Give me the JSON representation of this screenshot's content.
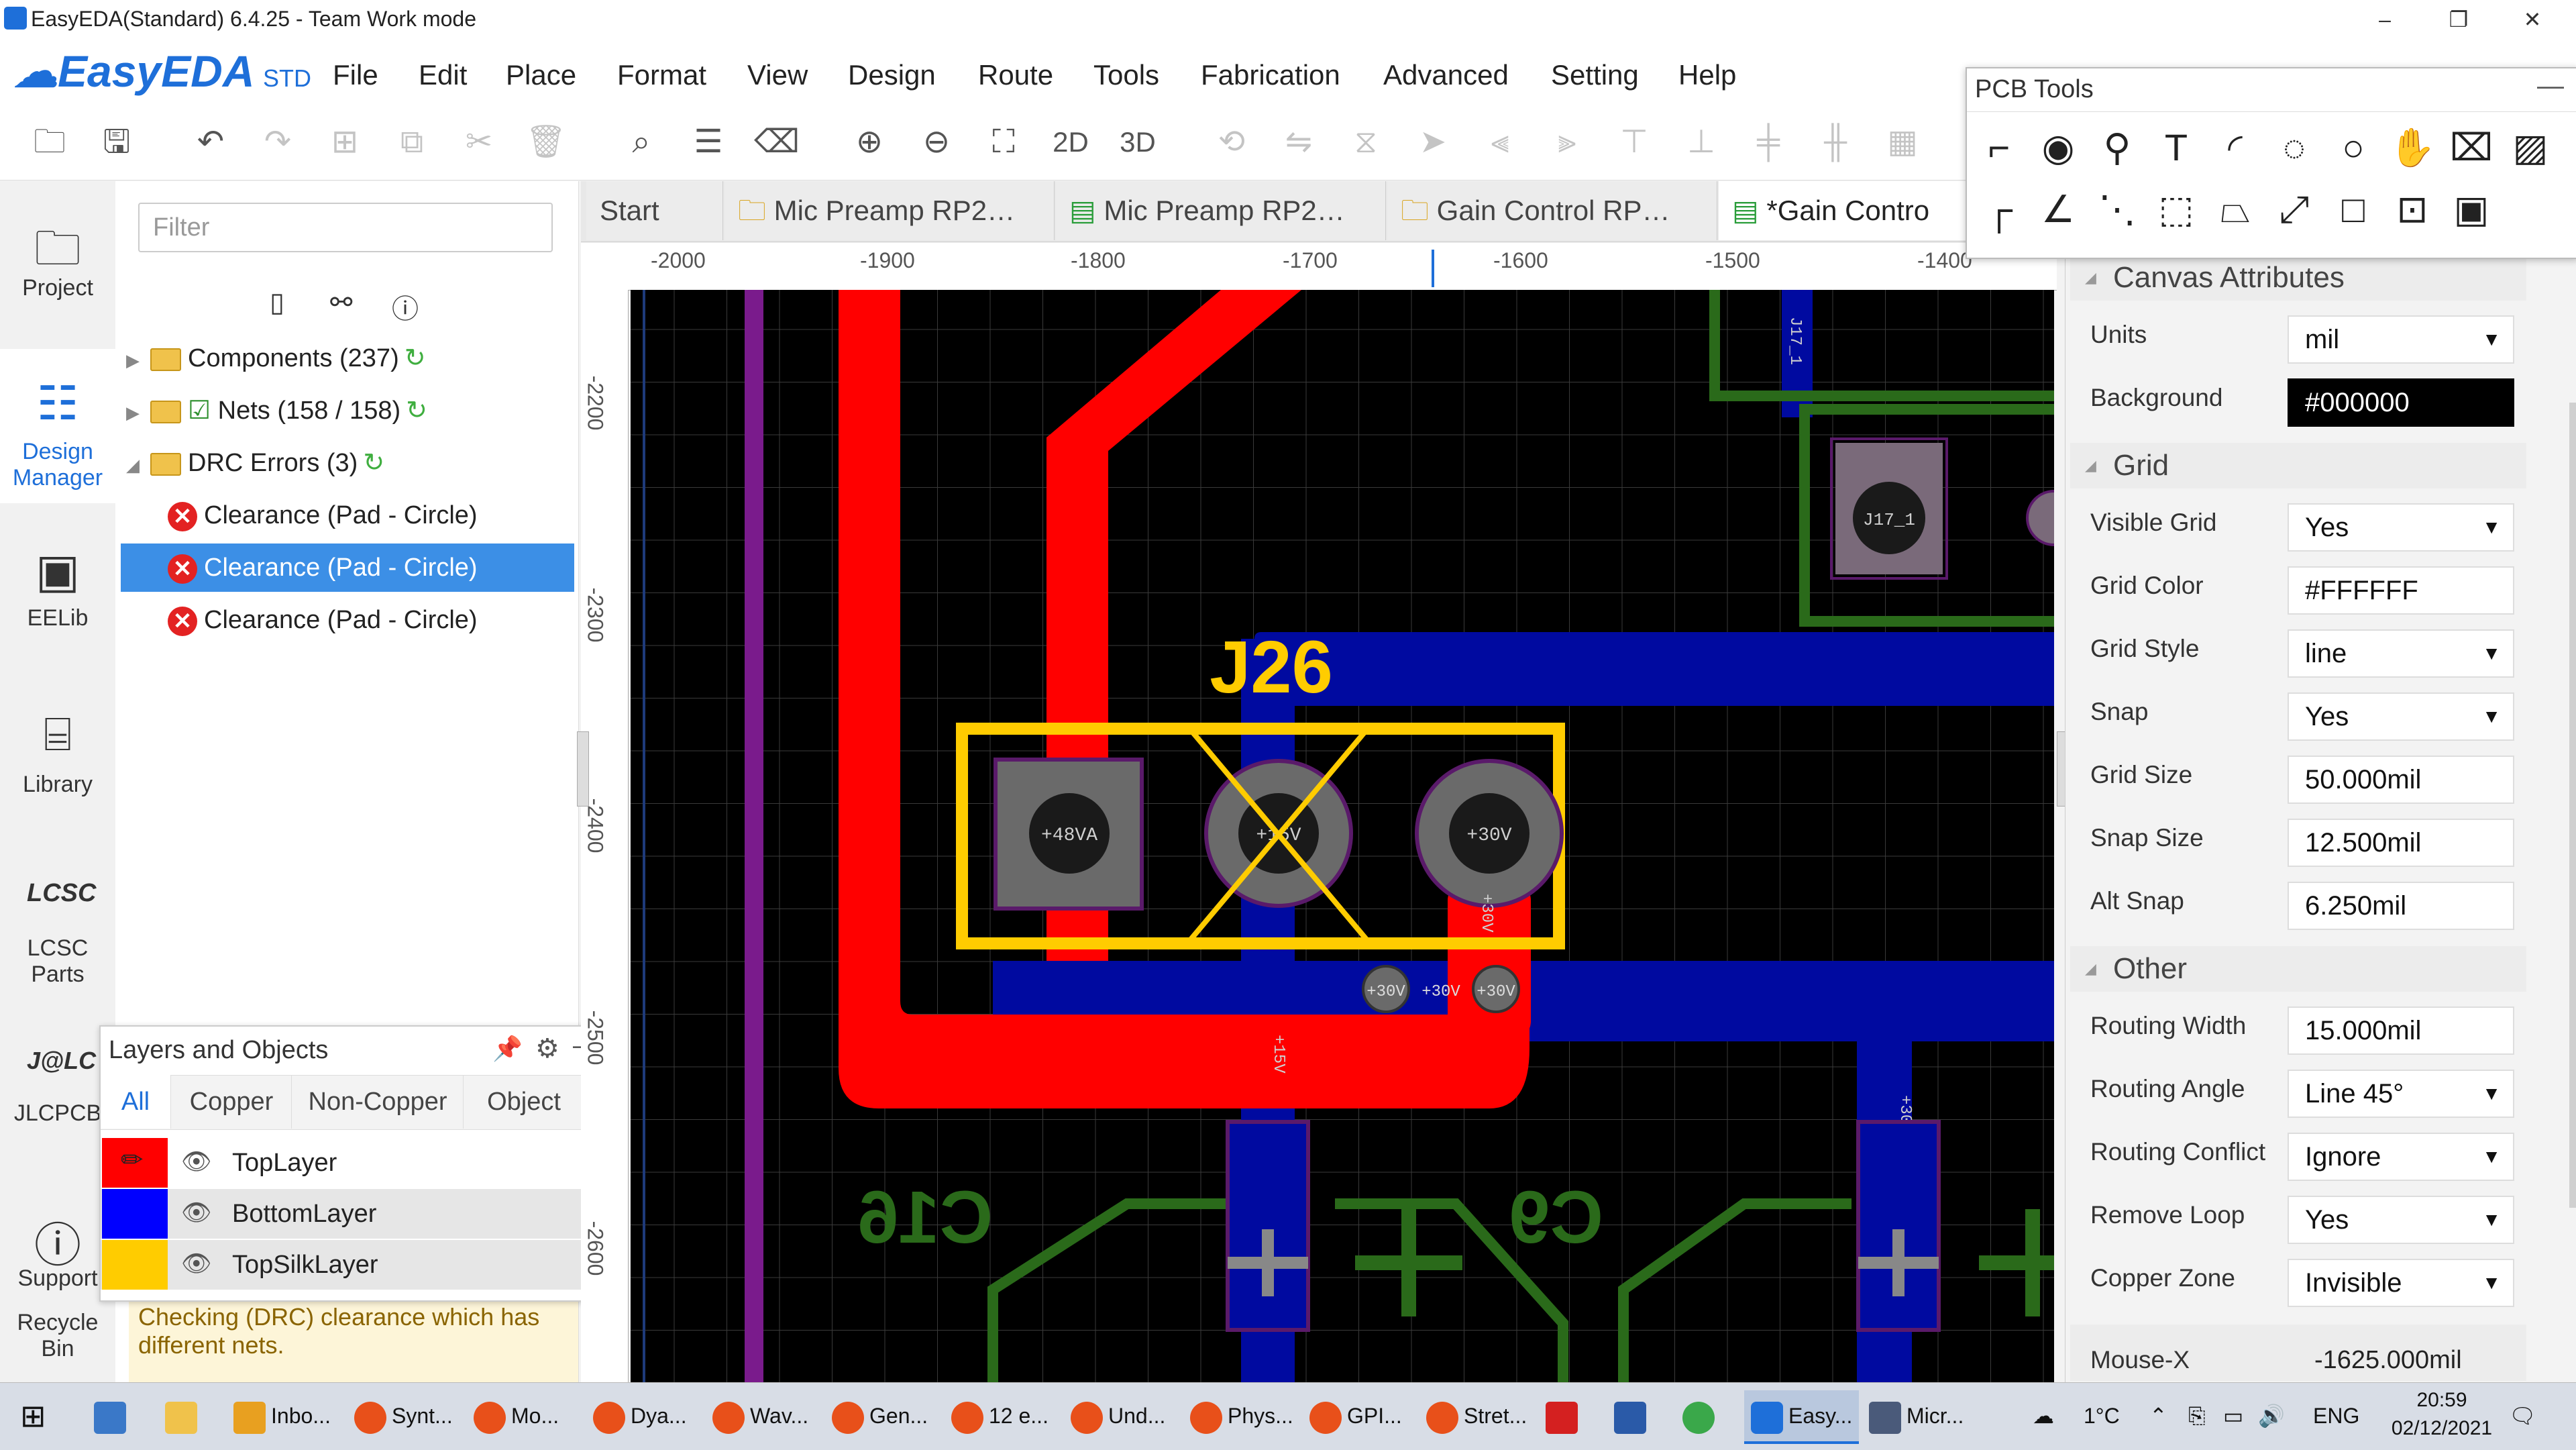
{
  "window": {
    "title": "EasyEDA(Standard) 6.4.25 - Team Work mode",
    "controls": [
      "–",
      "❐",
      "✕"
    ]
  },
  "app": {
    "logo": "EasyEDA",
    "logo_suffix": "STD",
    "menu": [
      "File",
      "Edit",
      "Place",
      "Format",
      "View",
      "Design",
      "Route",
      "Tools",
      "Fabrication",
      "Advanced",
      "Setting",
      "Help"
    ]
  },
  "toolbar": {
    "view_2d": "2D",
    "view_3d": "3D"
  },
  "leftnav": [
    {
      "label": "Project",
      "icon": "folder-icon"
    },
    {
      "label": "Design Manager",
      "icon": "list-icon"
    },
    {
      "label": "EELib",
      "icon": "chip-icon"
    },
    {
      "label": "Library",
      "icon": "library-icon"
    },
    {
      "label": "LCSC Parts",
      "icon": "lcsc-icon"
    },
    {
      "label": "JLCPCB",
      "icon": "jlc-icon"
    },
    {
      "label": "Support",
      "icon": "help-icon"
    },
    {
      "label": "Recycle Bin",
      "icon": "trash-icon"
    }
  ],
  "design_manager": {
    "filter_placeholder": "Filter",
    "tree": [
      {
        "label": "Components (237)"
      },
      {
        "label": "Nets (158 / 158)"
      },
      {
        "label": "DRC Errors (3)"
      }
    ],
    "errors": [
      "Clearance (Pad - Circle)",
      "Clearance (Pad - Circle)",
      "Clearance (Pad - Circle)"
    ],
    "selected_error_index": 1,
    "message": "Checking (DRC) clearance which has different nets."
  },
  "layers_panel": {
    "title": "Layers and Objects",
    "tabs": [
      "All",
      "Copper",
      "Non-Copper",
      "Object"
    ],
    "active_tab": "All",
    "layers": [
      {
        "name": "TopLayer",
        "color": "#ff0000"
      },
      {
        "name": "BottomLayer",
        "color": "#0000ff"
      },
      {
        "name": "TopSilkLayer",
        "color": "#ffcc00"
      }
    ]
  },
  "tabs": [
    {
      "label": "Start"
    },
    {
      "label": "Mic Preamp RP2…"
    },
    {
      "label": "Mic Preamp RP2…"
    },
    {
      "label": "Gain Control RP…"
    },
    {
      "label": "*Gain Contro"
    }
  ],
  "ruler": {
    "x_ticks": [
      "-2000",
      "-1900",
      "-1800",
      "-1700",
      "-1600",
      "-1500",
      "-1400"
    ],
    "y_ticks": [
      "-2200",
      "-2300",
      "-2400",
      "-2500",
      "-2600"
    ]
  },
  "pcb": {
    "designator": "J26",
    "pads": [
      "+48VA",
      "+15V",
      "+30V"
    ],
    "small_pads": [
      "+30V",
      "+30V",
      "+30V"
    ],
    "connector": "J17_1",
    "connector_small": "J17_1",
    "track_labels": [
      "+15V",
      "+30V",
      "+30V"
    ],
    "silk_labels": [
      "C16",
      "C9"
    ],
    "colors": {
      "top": "#ff0000",
      "bottom": "#000aa0",
      "silk": "#ffcc00",
      "outline": "#2a6a1a",
      "grid": "#3a3a3a"
    }
  },
  "pcb_tools": {
    "title": "PCB Tools"
  },
  "properties": {
    "canvas_title": "Canvas Attributes",
    "units": {
      "label": "Units",
      "value": "mil"
    },
    "background": {
      "label": "Background",
      "value": "#000000"
    },
    "grid_title": "Grid",
    "visible_grid": {
      "label": "Visible Grid",
      "value": "Yes"
    },
    "grid_color": {
      "label": "Grid Color",
      "value": "#FFFFFF"
    },
    "grid_style": {
      "label": "Grid Style",
      "value": "line"
    },
    "snap": {
      "label": "Snap",
      "value": "Yes"
    },
    "grid_size": {
      "label": "Grid Size",
      "value": "50.000mil"
    },
    "snap_size": {
      "label": "Snap Size",
      "value": "12.500mil"
    },
    "alt_snap": {
      "label": "Alt Snap",
      "value": "6.250mil"
    },
    "other_title": "Other",
    "routing_width": {
      "label": "Routing Width",
      "value": "15.000mil"
    },
    "routing_angle": {
      "label": "Routing Angle",
      "value": "Line 45°"
    },
    "routing_conflict": {
      "label": "Routing Conflict",
      "value": "Ignore"
    },
    "remove_loop": {
      "label": "Remove Loop",
      "value": "Yes"
    },
    "copper_zone": {
      "label": "Copper Zone",
      "value": "Invisible"
    },
    "mouse_x": {
      "label": "Mouse-X",
      "value": "-1625.000mil"
    }
  },
  "taskbar": {
    "apps": [
      "Inbo...",
      "Synt...",
      "Mo...",
      "Dya...",
      "Wav...",
      "Gen...",
      "12 e...",
      "Und...",
      "Phys...",
      "GPI...",
      "Stret...",
      "Easy...",
      "Micr..."
    ],
    "temperature": "1°C",
    "language": "ENG",
    "time": "20:59",
    "date": "02/12/2021"
  }
}
